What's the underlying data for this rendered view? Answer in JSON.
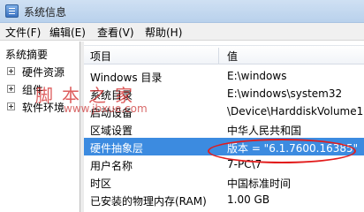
{
  "window": {
    "title": "系统信息"
  },
  "menu": {
    "file": "文件(F)",
    "edit": "编辑(E)",
    "view": "查看(V)",
    "help": "帮助(H)"
  },
  "tree": {
    "root": "系统摘要",
    "nodes": [
      "硬件资源",
      "组件",
      "软件环境"
    ]
  },
  "table": {
    "headers": {
      "item": "项目",
      "value": "值"
    },
    "rows": [
      {
        "item": "Windows 目录",
        "value": "E:\\windows"
      },
      {
        "item": "系统目录",
        "value": "E:\\windows\\system32"
      },
      {
        "item": "启动设备",
        "value": "\\Device\\HarddiskVolume1"
      },
      {
        "item": "区域设置",
        "value": "中华人民共和国"
      },
      {
        "item": "硬件抽象层",
        "value": "版本 = \"6.1.7600.16385\"",
        "selected": true
      },
      {
        "item": "用户名称",
        "value": "7-PC\\7"
      },
      {
        "item": "时区",
        "value": "中国标准时间"
      },
      {
        "item": "已安装的物理内存(RAM)",
        "value": "1.00 GB"
      }
    ]
  },
  "watermark": {
    "text": "脚本之家",
    "url": "www.jbxue.com"
  },
  "colors": {
    "selection": "#3c8be0",
    "annotation": "#e21b1b"
  }
}
